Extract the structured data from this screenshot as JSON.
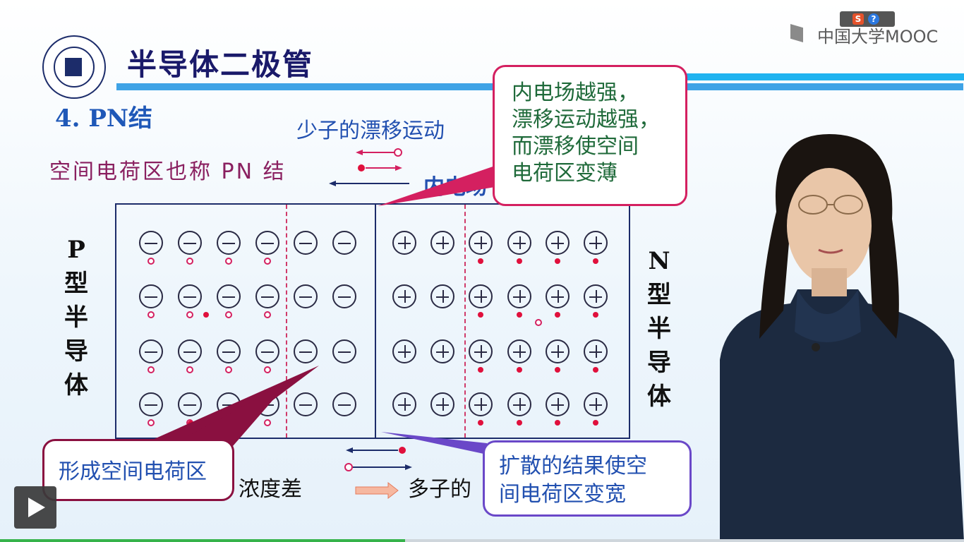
{
  "header": {
    "title": "半导体二极管",
    "subtitle": "4. PN结"
  },
  "labels": {
    "drift": "少子的漂移运动",
    "space_charge": "空间电荷区也称 PN 结",
    "inner_field": "内电场",
    "p_type": [
      "P",
      "型",
      "半",
      "导",
      "体"
    ],
    "n_type": [
      "N",
      "型",
      "半",
      "导",
      "体"
    ],
    "concentration": "浓度差",
    "majority": "多子的"
  },
  "callouts": {
    "field_strong": "内电场越强，\n漂移运动越强，\n而漂移使空间\n电荷区变薄",
    "form_region": "形成空间电荷区",
    "diffusion_result": "扩散的结果使空\n间电荷区变宽"
  },
  "branding": {
    "platform": "中国大学MOOC",
    "s_icon_text": "S",
    "help_icon_text": "?"
  },
  "player": {
    "progress_fraction": 0.42
  },
  "colors": {
    "title": "#1a1a6a",
    "accent_blue": "#3fa3e6",
    "callout_pink": "#d42060",
    "callout_purple": "#6a48c8"
  }
}
